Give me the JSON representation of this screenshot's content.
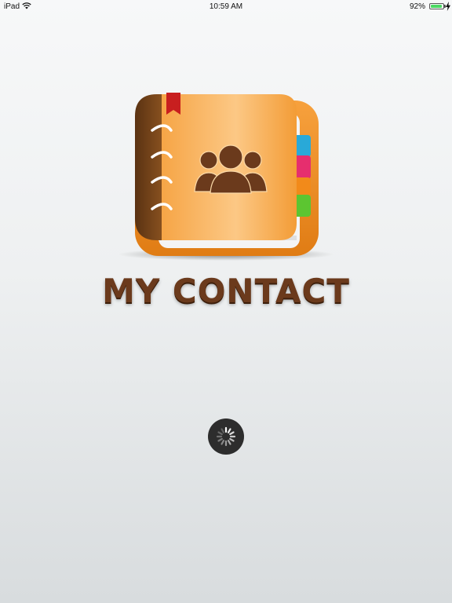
{
  "status_bar": {
    "device": "iPad",
    "time": "10:59 AM",
    "battery_percent": "92%",
    "battery_level": 0.92,
    "battery_color": "#4cd964",
    "wifi_icon": "wifi-icon",
    "charging_icon": "bolt-icon"
  },
  "splash": {
    "app_icon": "address-book-icon",
    "title": "MY CONTACT",
    "title_color": "#6b3a1c",
    "loading_indicator": "spinner-icon"
  }
}
